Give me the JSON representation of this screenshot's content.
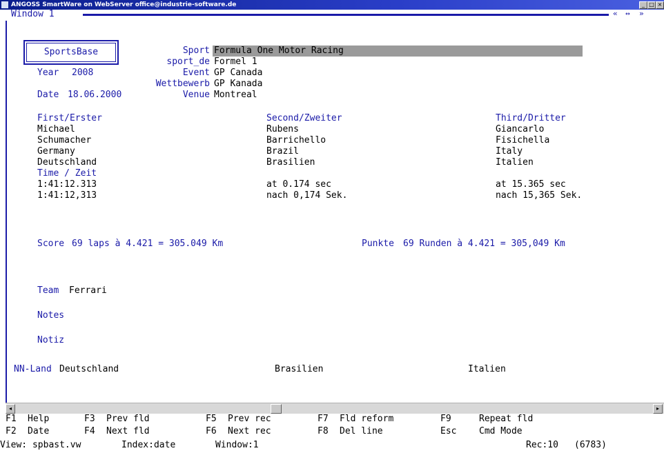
{
  "window": {
    "title": "ANGOSS SmartWare on WebServer office@industrie-software.de",
    "min_glyph": "_",
    "max_glyph": "□",
    "close_glyph": "×"
  },
  "inner_window": {
    "title": "Window 1",
    "controls": [
      "«",
      "↔",
      "»"
    ]
  },
  "form": {
    "sportsbase_label": "SportsBase",
    "sport_label": "Sport",
    "sport_value": "Formula One Motor Racing",
    "sport_de_label": "sport_de",
    "sport_de_value": "Formel 1",
    "year_label": "Year",
    "year_value": "2008",
    "event_label": "Event",
    "event_value": "GP Canada",
    "wettbewerb_label": "Wettbewerb",
    "wettbewerb_value": "GP Kanada",
    "date_label": "Date",
    "date_value": "18.06.2000",
    "venue_label": "Venue",
    "venue_value": "Montreal",
    "first": {
      "header": "First/Erster",
      "first_name": "Michael",
      "last_name": "Schumacher",
      "country": "Germany",
      "country_de": "Deutschland"
    },
    "second": {
      "header": "Second/Zweiter",
      "first_name": "Rubens",
      "last_name": "Barrichello",
      "country": "Brazil",
      "country_de": "Brasilien",
      "time": "at 0.174 sec",
      "time_de": "nach 0,174 Sek."
    },
    "third": {
      "header": "Third/Dritter",
      "first_name": "Giancarlo",
      "last_name": "Fisichella",
      "country": "Italy",
      "country_de": "Italien",
      "time": "at 15.365 sec",
      "time_de": "nach 15,365 Sek."
    },
    "time_label": "Time / Zeit",
    "time_value": "1:41:12.313",
    "time_value_de": "1:41:12,313",
    "score_label": "Score",
    "score_value": "69 laps à 4.421 = 305.049 Km",
    "punkte_label": "Punkte",
    "punkte_value": "69 Runden à 4.421 = 305,049 Km",
    "team_label": "Team",
    "team_value": "Ferrari",
    "notes_label": "Notes",
    "notiz_label": "Notiz",
    "nnland_label": "NN-Land",
    "nnland_first": "Deutschland",
    "nnland_second": "Brasilien",
    "nnland_third": "Italien"
  },
  "scrollbar": {
    "left_glyph": "◂",
    "right_glyph": "▸"
  },
  "function_keys": [
    [
      "F1",
      "Help"
    ],
    [
      "F3",
      "Prev fld"
    ],
    [
      "F5",
      "Prev rec"
    ],
    [
      "F7",
      "Fld reform"
    ],
    [
      "F9",
      "Repeat fld"
    ],
    [
      "F2",
      "Date"
    ],
    [
      "F4",
      "Next fld"
    ],
    [
      "F6",
      "Next rec"
    ],
    [
      "F8",
      "Del line"
    ],
    [
      "Esc",
      "Cmd Mode"
    ]
  ],
  "status": {
    "view": "View: spbast.vw",
    "index": "Index:date",
    "window": "Window:1",
    "rec": "Rec:10",
    "total": "(6783)"
  },
  "colors": {
    "label_blue": "#1a1aa8",
    "title_bar": "#0a1e8c",
    "sport_field_bg": "#9a9a9a"
  }
}
